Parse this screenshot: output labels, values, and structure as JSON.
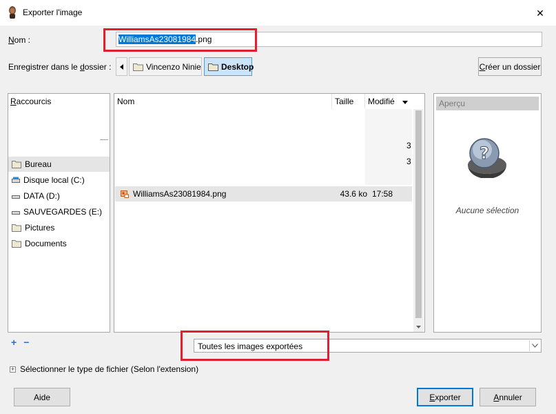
{
  "window": {
    "title": "Exporter l'image",
    "close_glyph": "✕"
  },
  "name_row": {
    "label_u": "N",
    "label_rest": "om :",
    "filename_selected": "WilliamsAs23081984",
    "filename_ext": ".png"
  },
  "folder_row": {
    "label_pre": "Enregistrer dans le ",
    "label_u": "d",
    "label_post": "ossier :",
    "breadcrumb": [
      {
        "label": "Vincenzo Ninie",
        "active": false
      },
      {
        "label": "Desktop",
        "active": true
      }
    ],
    "create_folder_u": "C",
    "create_folder_rest": "réer un dossier"
  },
  "places": {
    "header_u": "R",
    "header_rest": "accourcis",
    "items": [
      {
        "label": "Bureau",
        "icon": "folder-icon",
        "highlighted": true
      },
      {
        "label": "Disque local (C:)",
        "icon": "drive-icon",
        "highlighted": false
      },
      {
        "label": "DATA (D:)",
        "icon": "drive-icon",
        "highlighted": false
      },
      {
        "label": "SAUVEGARDES (E:)",
        "icon": "drive-icon",
        "highlighted": false
      },
      {
        "label": "Pictures",
        "icon": "folder-icon",
        "highlighted": false
      },
      {
        "label": "Documents",
        "icon": "folder-icon",
        "highlighted": false
      }
    ],
    "add_glyph": "+",
    "remove_glyph": "−"
  },
  "files": {
    "columns": {
      "name": "Nom",
      "size": "Taille",
      "modified": "Modifié"
    },
    "clipped_text": "3",
    "rows": [
      {
        "name": "WilliamsAs23081984.png",
        "size": "43.6 ko",
        "modified": "17:58",
        "icon": "image-file-icon"
      }
    ]
  },
  "preview": {
    "header": "Aperçu",
    "empty_text": "Aucune sélection"
  },
  "filter": {
    "selected": "Toutes les images exportées"
  },
  "file_type": {
    "label": "Sélectionner le type de fichier (Selon l'extension)"
  },
  "buttons": {
    "help": "Aide",
    "export_u": "E",
    "export_rest": "xporter",
    "cancel_u": "A",
    "cancel_rest": "nnuler"
  },
  "colors": {
    "selection": "#0078d7",
    "highlight_box": "#e0202e",
    "active_crumb": "#cce4f7"
  }
}
